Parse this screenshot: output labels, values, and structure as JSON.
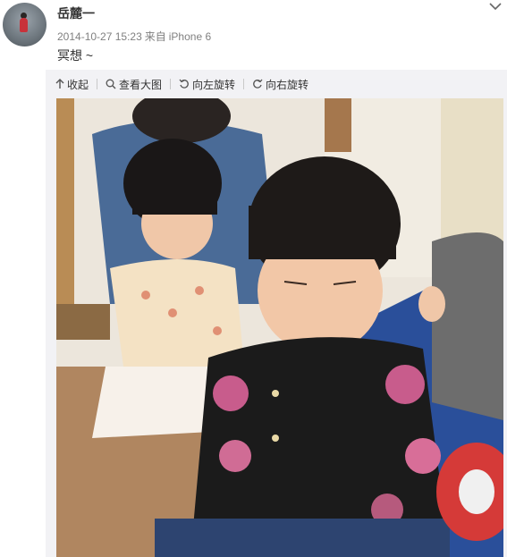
{
  "user": {
    "name": "岳麓一"
  },
  "post": {
    "date": "2014-10-27 15:23",
    "source_prefix": "来自",
    "source": "iPhone 6",
    "text": "冥想 ~"
  },
  "toolbar": {
    "collapse_label": "收起",
    "view_large_label": "查看大图",
    "rotate_left_label": "向左旋转",
    "rotate_right_label": "向右旋转"
  },
  "colors": {
    "text_primary": "#333333",
    "text_secondary": "#808080",
    "toolbar_bg": "#f2f2f5"
  },
  "icons": [
    "chevron-down-icon",
    "up-arrow-icon",
    "magnifier-icon",
    "rotate-left-icon",
    "rotate-right-icon"
  ]
}
